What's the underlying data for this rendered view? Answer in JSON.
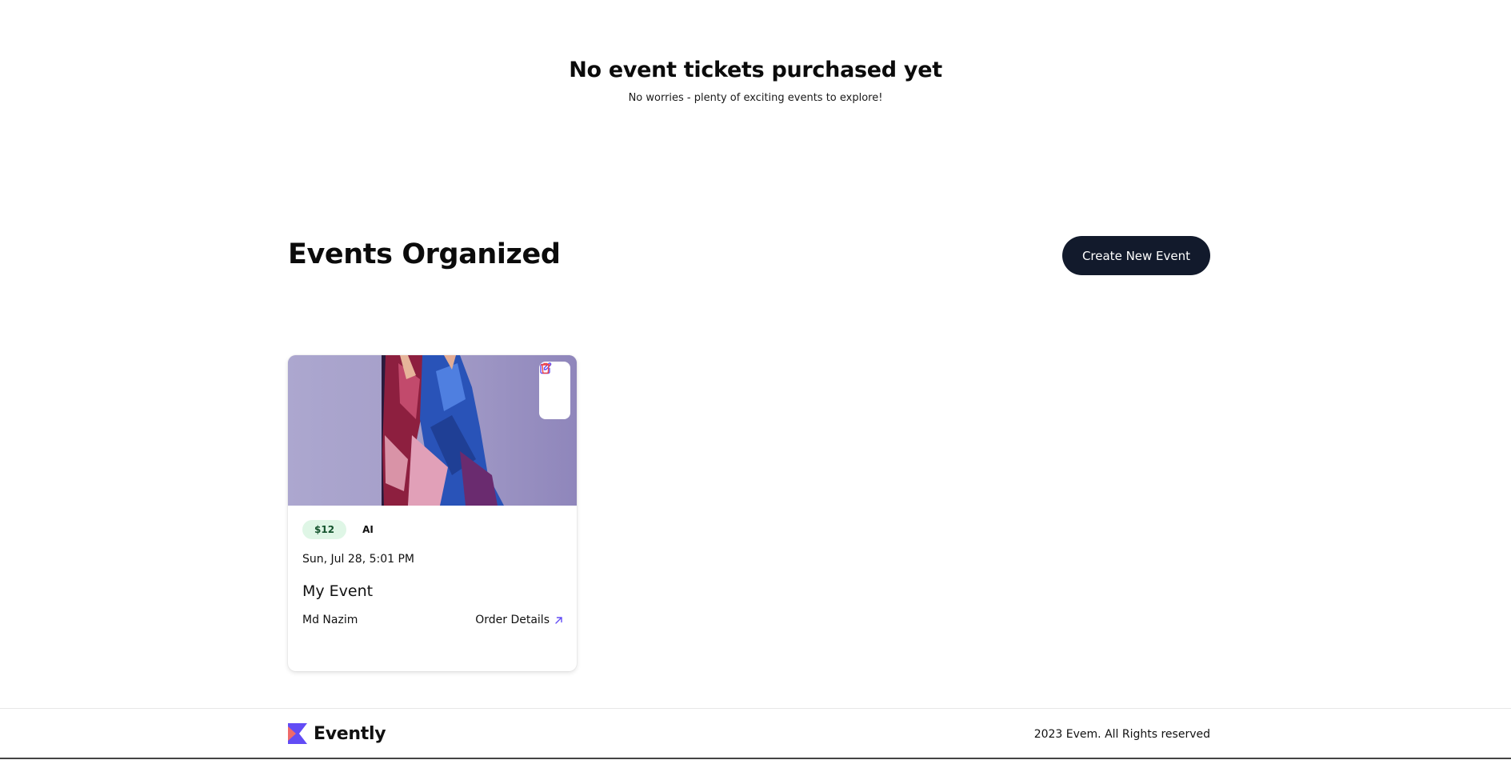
{
  "tickets_section": {
    "empty_title": "No event tickets purchased yet",
    "empty_subtitle": "No worries - plenty of exciting events to explore!"
  },
  "organized_section": {
    "title": "Events Organized",
    "create_button_label": "Create New Event"
  },
  "events": [
    {
      "image_alt": "event image",
      "price": "$12",
      "category": "AI",
      "date": "Sun, Jul 28, 5:01 PM",
      "title": "My Event",
      "organizer": "Md Nazim",
      "order_link_label": "Order Details",
      "actions": [
        "pencil-edit-icon",
        "trash-icon"
      ]
    }
  ],
  "footer": {
    "brand": "Evently",
    "copyright": "2023 Evem. All Rights reserved"
  },
  "colors": {
    "primary_dark": "#121a2c",
    "accent_purple": "#624cf5",
    "delete_red": "#ef4444",
    "price_badge_bg": "#dff6e6"
  }
}
